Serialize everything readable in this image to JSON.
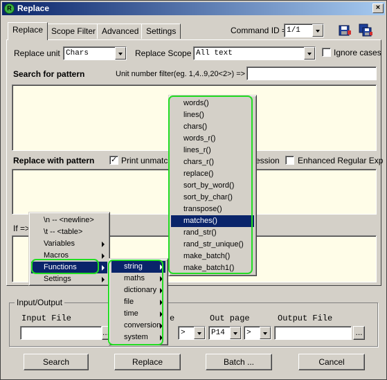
{
  "window": {
    "title": "Replace",
    "close_glyph": "×"
  },
  "tabs": [
    {
      "label": "Replace",
      "active": true
    },
    {
      "label": "Scope Filter"
    },
    {
      "label": "Advanced"
    },
    {
      "label": "Settings"
    }
  ],
  "command": {
    "label": "Command ID =>",
    "value": "1/1",
    "icons": [
      "save-icon",
      "save-all-icon"
    ]
  },
  "replace_unit": {
    "label": "Replace unit",
    "value": "Chars"
  },
  "replace_scope": {
    "label": "Replace Scope",
    "value": "All text"
  },
  "ignore_cases": {
    "label": "Ignore cases",
    "checked": false
  },
  "search": {
    "heading": "Search for pattern",
    "unit_filter_label": "Unit number filter(eg. 1,4..9,20<2>) =>",
    "unit_filter_value": "",
    "pattern_value": ""
  },
  "replace": {
    "heading": "Replace with pattern",
    "print_unmatched_label": "Print unmatche",
    "print_unmatched_checked": true,
    "regex_label_tail": "ession",
    "enhanced_regex_label": "Enhanced Regular Exp",
    "enhanced_regex_checked": false,
    "pattern_value": ""
  },
  "if_label": "If =>",
  "io": {
    "group_label": "Input/Output",
    "input_file_label": "Input File",
    "input_file_value": "",
    "out_page_label": "Out page",
    "out_page_value": "P14",
    "op_value": ">",
    "output_file_label": "Output File",
    "output_file_value": "",
    "browse_label": "...",
    "partial_label_tail": "e"
  },
  "buttons": {
    "search": "Search",
    "replace": "Replace",
    "batch": "Batch ...",
    "cancel": "Cancel"
  },
  "context_menu": {
    "items": [
      "\\n -- <newline>",
      "\\t -- <table>",
      "Variables",
      "Macros",
      "Functions",
      "Settings"
    ],
    "highlighted": "Functions"
  },
  "functions_submenu": {
    "items": [
      "string",
      "maths",
      "dictionary",
      "file",
      "time",
      "conversion",
      "system"
    ],
    "highlighted": "string"
  },
  "string_submenu": {
    "items": [
      "words()",
      "lines()",
      "chars()",
      "words_r()",
      "lines_r()",
      "chars_r()",
      "replace()",
      "sort_by_word()",
      "sort_by_char()",
      "transpose()",
      "matches()",
      "rand_str()",
      "rand_str_unique()",
      "make_batch()",
      "make_batch1()"
    ],
    "highlighted": "matches()"
  },
  "colors": {
    "title_start": "#0a246a",
    "title_end": "#a6caf0",
    "highlight": "#0a246a",
    "annotation_ring": "#22dd22",
    "pattern_bg": "#fffde8"
  }
}
